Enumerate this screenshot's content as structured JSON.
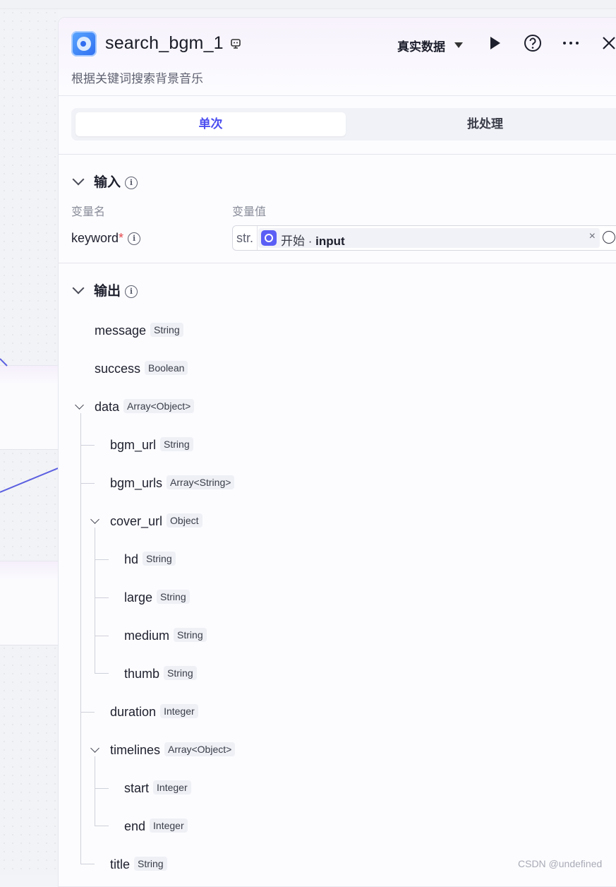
{
  "header": {
    "title": "search_bgm_1",
    "description": "根据关键词搜索背景音乐",
    "mode_label": "真实数据",
    "icons": [
      "edit-icon",
      "caret-down-icon",
      "play-icon",
      "help-icon",
      "more-icon",
      "close-icon"
    ]
  },
  "tabs": {
    "single": "单次",
    "batch": "批处理"
  },
  "input": {
    "title": "输入",
    "col_name": "变量名",
    "col_value": "变量值",
    "var_name": "keyword",
    "required_mark": "*",
    "type_prefix": "str.",
    "ref_source": "开始",
    "ref_sep": " · ",
    "ref_field": "input",
    "clear": "×"
  },
  "output": {
    "title": "输出",
    "fields": [
      {
        "name": "message",
        "type": "String"
      },
      {
        "name": "success",
        "type": "Boolean"
      },
      {
        "name": "data",
        "type": "Array<Object>"
      },
      {
        "name": "bgm_url",
        "type": "String"
      },
      {
        "name": "bgm_urls",
        "type": "Array<String>"
      },
      {
        "name": "cover_url",
        "type": "Object"
      },
      {
        "name": "hd",
        "type": "String"
      },
      {
        "name": "large",
        "type": "String"
      },
      {
        "name": "medium",
        "type": "String"
      },
      {
        "name": "thumb",
        "type": "String"
      },
      {
        "name": "duration",
        "type": "Integer"
      },
      {
        "name": "timelines",
        "type": "Array<Object>"
      },
      {
        "name": "start",
        "type": "Integer"
      },
      {
        "name": "end",
        "type": "Integer"
      },
      {
        "name": "title",
        "type": "String"
      }
    ]
  },
  "watermark": "CSDN @undefined",
  "colors": {
    "accent": "#4b4df0",
    "required": "#e5484d",
    "wire": "#5b5fe0"
  }
}
